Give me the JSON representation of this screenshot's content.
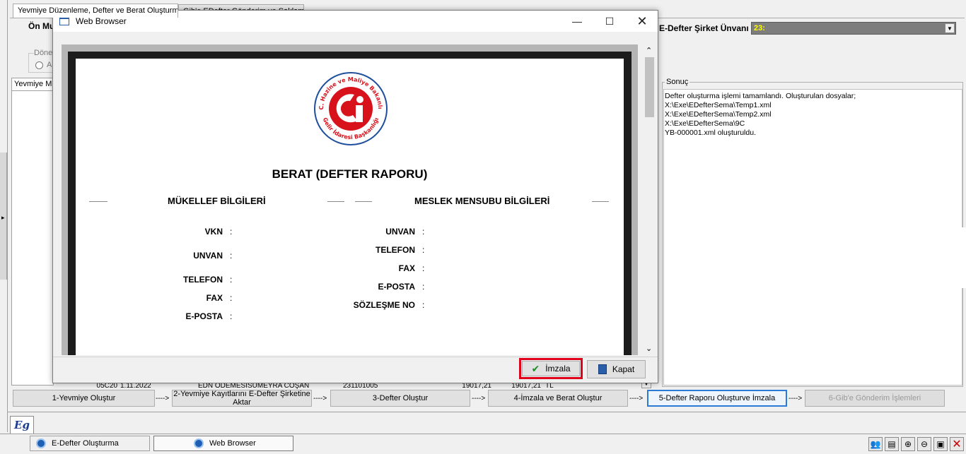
{
  "app": {
    "tabs": [
      "Yevmiye Düzenleme, Defter ve Berat Oluşturma",
      "Gib'e EDefter Gönderim ve Saklama"
    ],
    "on_label": "Ön Mu",
    "donem_label": "Döne",
    "radio_label": "A",
    "grid_header": "Yevmiye M",
    "company_label": "E-Defter Şirket Ünvanı",
    "company_value": "23:",
    "sonuc_label": "Sonuç",
    "sonuc_lines": [
      "Defter oluşturma işlemi tamamlandı. Oluşturulan dosyalar;",
      "X:\\Exe\\EDefterSema\\Temp1.xml",
      "X:\\Exe\\EDefterSema\\Temp2.xml",
      "X:\\Exe\\EDefterSema\\9C",
      "YB-000001.xml oluşturuldu."
    ],
    "grid_row": [
      "05C20",
      "1.11.2022",
      "EDN ÖDEMESİ",
      "SÜMEYRA COŞAN",
      "231101005",
      "19017,21",
      "19017,21",
      "TL"
    ],
    "steps": [
      "1-Yevmiye Oluştur",
      "2-Yevmiye Kayıtlarını E-Defter Şirketine Aktar",
      "3-Defter Oluştur",
      "4-İmzala ve Berat Oluştur",
      "5-Defter Raporu Oluşturve İmzala",
      "6-Gib'e Gönderim İşlemleri"
    ],
    "step_arrow": "---->",
    "logo_text": "Eg",
    "taskbar": [
      "E-Defter Oluşturma",
      "Web Browser"
    ]
  },
  "dialog": {
    "title": "Web Browser",
    "report_title": "BERAT (DEFTER RAPORU)",
    "left_heading": "MÜKELLEF BİLGİLERİ",
    "right_heading": "MESLEK MENSUBU BİLGİLERİ",
    "left_fields": [
      "VKN",
      "UNVAN",
      "TELEFON",
      "FAX",
      "E-POSTA"
    ],
    "right_fields": [
      "UNVAN",
      "TELEFON",
      "FAX",
      "E-POSTA",
      "SÖZLEŞME NO"
    ],
    "colon": ":",
    "seal_top": "T.C. Hazine ve Maliye Bakanlığı",
    "seal_bottom": "Gelir İdaresi Başkanlığı",
    "sign_button": "İmzala",
    "close_button": "Kapat"
  },
  "colors": {
    "accent": "#2a7ad6",
    "highlight": "#e0001b",
    "seal_red": "#d8121b",
    "seal_blue": "#1f4f9c",
    "company_bg": "#7d7d7d",
    "company_text": "#ffff00"
  }
}
